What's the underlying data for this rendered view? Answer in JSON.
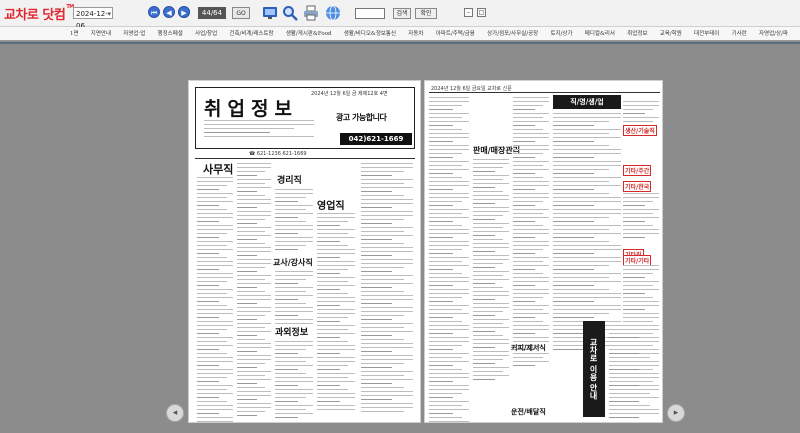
{
  "app": {
    "logo_text": "교차로 닷컴",
    "logo_badge": "TM"
  },
  "toolbar": {
    "date_value": "2024-12-06",
    "page_indicator": "44/64",
    "go_label": "GO",
    "search_button_label": "검색",
    "extra_button_label": "확인",
    "nav_icons": [
      "first-page-icon",
      "prev-page-icon",
      "next-page-icon",
      "last-page-icon"
    ],
    "tool_icons": [
      "monitor-icon",
      "zoom-icon",
      "print-icon",
      "globe-icon"
    ]
  },
  "menu": {
    "items": [
      "1면",
      "지면안내",
      "자영업·업",
      "행정스페셜",
      "사업/창업",
      "건축/비계/레스토랑",
      "생활/게시판&Food",
      "생활/비디오&정보통신",
      "자동차",
      "아파트/주택/금융",
      "상가/점포/사무실/공장",
      "토지/상가",
      "메디컬&리서",
      "취업정보",
      "교육/학원",
      "대전부테이",
      "기사란",
      "자영업/상/파"
    ]
  },
  "newspaper": {
    "left_page": {
      "title": "취업정보",
      "header_date": "2024년 12월 6일 금 제제12호 4면",
      "ad_text": "광고 가능합니다",
      "ad_phone": "042)621-1669",
      "phone_strip": "☎ 621-1236    621-1669",
      "sections": [
        "사무직",
        "경리직",
        "영업직",
        "교사/강사직",
        "과외정보"
      ]
    },
    "right_page": {
      "header_text": "2024년 12월 6일 금요일 교차로 신문",
      "banner_title": "직/영/생/업",
      "sections": [
        "판매/매장관리",
        "커피/제서식",
        "운전/배달직"
      ],
      "tags": [
        "생산/기술직",
        "기타/주간",
        "기타/한국",
        "기타직",
        "기타/기타"
      ],
      "side_ad": "교차로 이용 안내"
    }
  },
  "colors": {
    "background": "#8c8c8c",
    "logo_red": "#e0262c",
    "nav_blue": "#3a6fd0",
    "tag_red": "#d62a2a"
  }
}
